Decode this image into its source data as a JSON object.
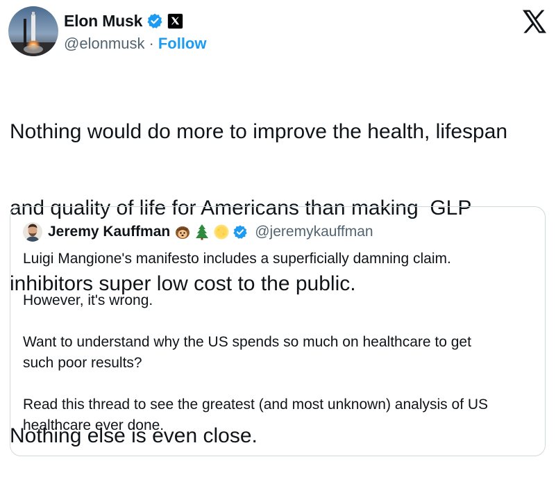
{
  "author": {
    "name": "Elon Musk",
    "handle": "@elonmusk",
    "separator": "·",
    "follow_label": "Follow",
    "verified_color": "#1d9bf0",
    "avatar_icon": "rocket-launch-avatar",
    "affiliate_icon": "x-logo-badge"
  },
  "brand_icon": "x-logo-icon",
  "tweet": {
    "line1": "Nothing would do more to improve the health, lifespan",
    "line2": "and quality of life for Americans than making  GLP",
    "line3": "inhibitors super low cost to the public.",
    "line4": "Nothing else is even close."
  },
  "quoted": {
    "name": "Jeremy Kauffman",
    "emojis": [
      "hedgehog-emoji",
      "evergreen-tree-emoji",
      "sun-emoji"
    ],
    "handle": "@jeremykauffman",
    "p1": "Luigi Mangione's manifesto includes a superficially damning claim.",
    "p2": "However, it's wrong.",
    "p3_line1": "Want to understand why the US spends so much on healthcare to get",
    "p3_line2": "such poor results?",
    "p4_line1": "Read this thread to see the greatest (and most unknown) analysis of US",
    "p4_line2": "healthcare ever done."
  },
  "colors": {
    "accent": "#1d9bf0",
    "text": "#0f1419",
    "secondary": "#536471",
    "border": "#cfd9de"
  }
}
